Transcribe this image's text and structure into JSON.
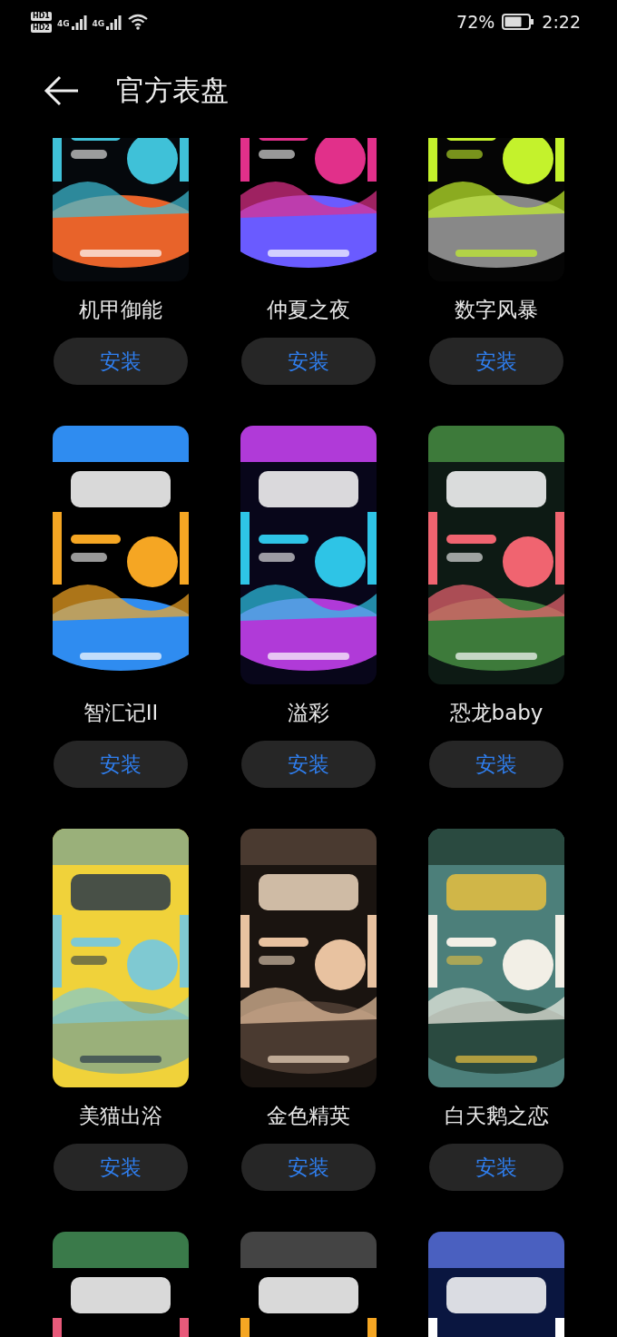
{
  "status_bar": {
    "hd_badges": [
      "HD1",
      "HD2"
    ],
    "signals": [
      {
        "network": "4G"
      },
      {
        "network": "4G"
      }
    ],
    "battery_percent": "72%",
    "battery": {
      "level": 0.72
    },
    "time": "2:22"
  },
  "header": {
    "title": "官方表盘"
  },
  "watch_faces": [
    {
      "name": "机甲御能",
      "preview": {
        "kind": "picture"
      },
      "button": "安装"
    },
    {
      "name": "仲夏之夜",
      "preview": {
        "kind": "picture"
      },
      "button": "安装"
    },
    {
      "name": "数字风暴",
      "preview": {
        "kind": "picture"
      },
      "button": "安装"
    },
    {
      "name": "智汇记II",
      "preview": {
        "kind": "picture"
      },
      "button": "安装"
    },
    {
      "name": "溢彩",
      "preview": {
        "kind": "picture"
      },
      "button": "安装"
    },
    {
      "name": "恐龙baby",
      "preview": {
        "kind": "picture"
      },
      "button": "安装"
    },
    {
      "name": "美猫出浴",
      "preview": {
        "kind": "picture"
      },
      "button": "安装"
    },
    {
      "name": "金色精英",
      "preview": {
        "kind": "picture"
      },
      "button": "安装"
    },
    {
      "name": "白天鹅之恋",
      "preview": {
        "kind": "picture"
      },
      "button": "安装"
    },
    {
      "preview": {
        "kind": "picture"
      }
    },
    {
      "preview": {
        "kind": "picture"
      }
    },
    {
      "preview": {
        "kind": "picture"
      }
    }
  ]
}
